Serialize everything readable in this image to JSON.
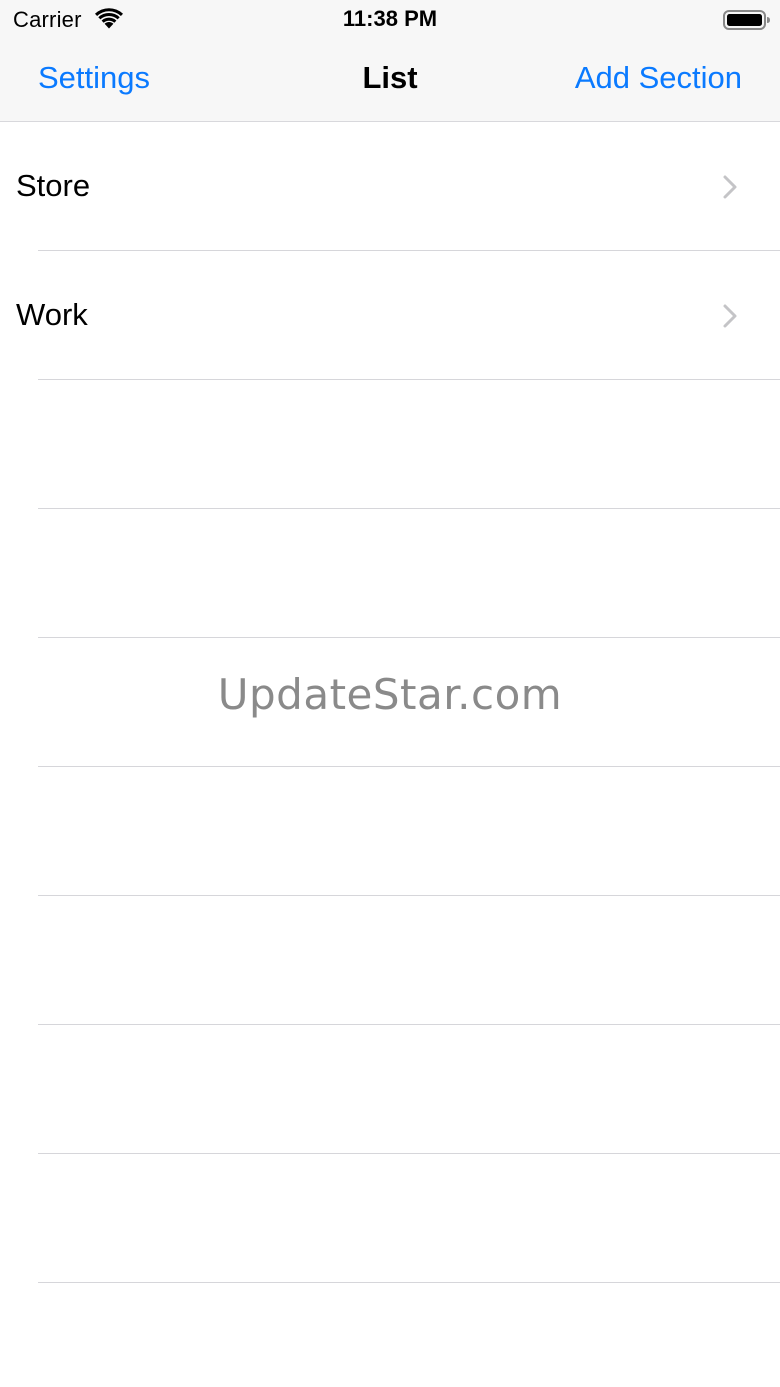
{
  "status_bar": {
    "carrier": "Carrier",
    "time": "11:38 PM",
    "wifi_icon": "wifi-icon",
    "battery_icon": "battery-icon"
  },
  "nav_bar": {
    "left_button": "Settings",
    "title": "List",
    "right_button": "Add Section"
  },
  "list": {
    "items": [
      {
        "label": "Store",
        "accessory": "chevron-right-icon"
      },
      {
        "label": "Work",
        "accessory": "chevron-right-icon"
      }
    ],
    "empty_rows": 7
  },
  "watermark": "UpdateStar.com",
  "colors": {
    "accent": "#0a7aff",
    "nav_background": "#f7f7f7",
    "separator": "#d6d6da",
    "chevron": "#c4c4c7",
    "watermark": "#8a8a8a"
  }
}
